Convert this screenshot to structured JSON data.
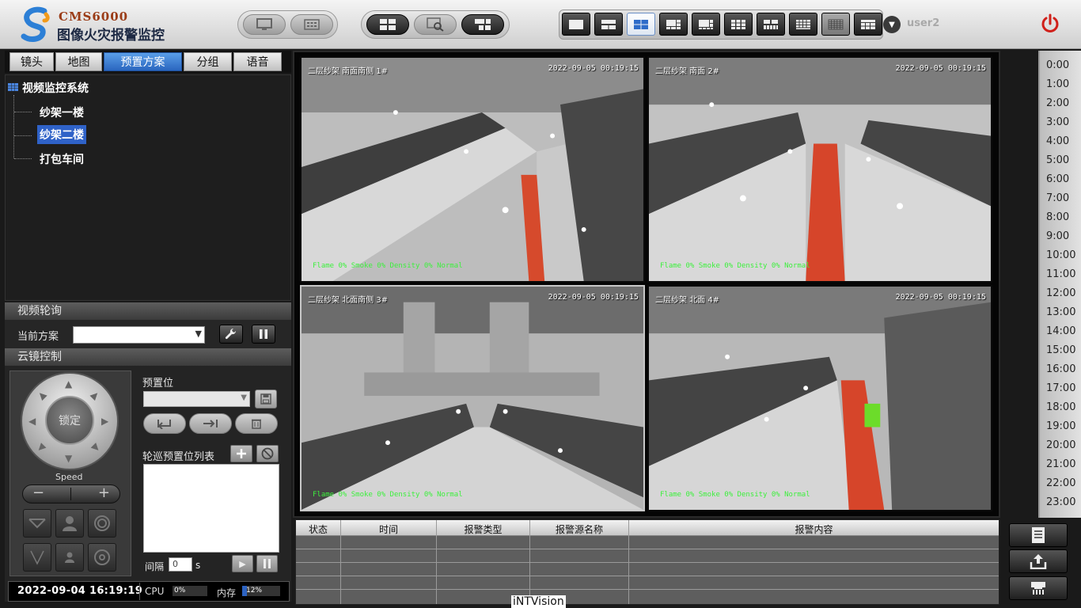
{
  "app": {
    "brand": "CMS6000",
    "title": "图像火灾报警监控",
    "user": "user2"
  },
  "nav_tabs": [
    {
      "label": "镜头"
    },
    {
      "label": "地图"
    },
    {
      "label": "预置方案",
      "active": true
    },
    {
      "label": "分组"
    },
    {
      "label": "语音"
    }
  ],
  "tree": {
    "root": "视频监控系统",
    "items": [
      {
        "label": "纱架一楼",
        "selected": false
      },
      {
        "label": "纱架二楼",
        "selected": true
      },
      {
        "label": "打包车间",
        "selected": false
      }
    ]
  },
  "tour": {
    "title": "视频轮询",
    "scheme_label": "当前方案",
    "scheme_value": ""
  },
  "ptz": {
    "title": "云镜控制",
    "lock_label": "锁定",
    "speed_label": "Speed",
    "minus": "−",
    "plus": "+",
    "preset_label": "预置位",
    "preset_value": "",
    "tour_list_label": "轮巡预置位列表",
    "interval_label": "间隔",
    "interval_value": "0",
    "interval_unit": "s"
  },
  "status": {
    "datetime": "2022-09-04  16:19:19",
    "cpu_label": "CPU",
    "cpu_value": "0%",
    "cpu_percent": 0,
    "mem_label": "内存",
    "mem_value": "12%",
    "mem_percent": 12
  },
  "videos": [
    {
      "name": "二层纱架 南面南侧 1#",
      "time": "2022-09-05  00:19:15",
      "status": "Flame 0% Smoke 0% Density 0% Normal",
      "selected": false
    },
    {
      "name": "二层纱架 南面 2#",
      "time": "2022-09-05  00:19:15",
      "status": "Flame 0% Smoke 0% Density 0% Normal",
      "selected": false
    },
    {
      "name": "二层纱架 北面南侧 3#",
      "time": "2022-09-05  00:19:15",
      "status": "Flame 0% Smoke 0% Density 0% Normal",
      "selected": true
    },
    {
      "name": "二层纱架 北面 4#",
      "time": "2022-09-05  00:19:15",
      "status": "Flame 0% Smoke 0% Density 0% Normal",
      "selected": false
    }
  ],
  "timeline": [
    "0:00",
    "1:00",
    "2:00",
    "3:00",
    "4:00",
    "5:00",
    "6:00",
    "7:00",
    "8:00",
    "9:00",
    "10:00",
    "11:00",
    "12:00",
    "13:00",
    "14:00",
    "15:00",
    "16:00",
    "17:00",
    "18:00",
    "19:00",
    "20:00",
    "21:00",
    "22:00",
    "23:00"
  ],
  "alarm_table": {
    "headers": [
      "状态",
      "时间",
      "报警类型",
      "报警源名称",
      "报警内容"
    ]
  },
  "watermark": "iNTVision",
  "colors": {
    "accent": "#2f62c8",
    "status_green": "#3df03d",
    "power": "#d0201a"
  }
}
